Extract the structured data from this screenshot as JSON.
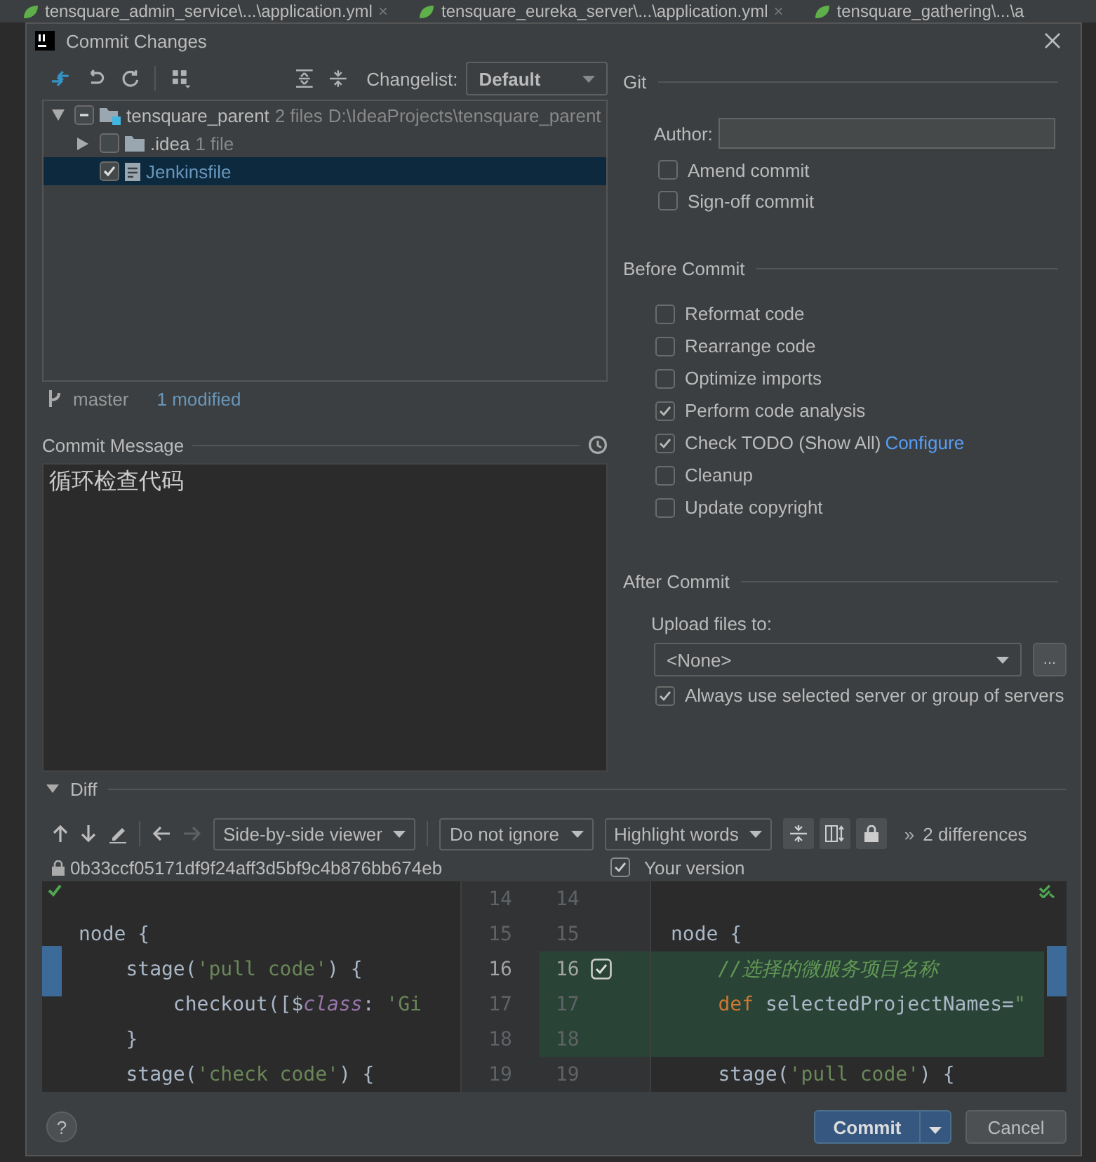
{
  "editor_tabs": [
    {
      "label": "tensquare_admin_service\\...\\application.yml",
      "close": "×"
    },
    {
      "label": "tensquare_eureka_server\\...\\application.yml",
      "close": "×"
    },
    {
      "label": "tensquare_gathering\\...\\a"
    }
  ],
  "window": {
    "title": "Commit Changes"
  },
  "changes": {
    "changelist_label": "Changelist:",
    "changelist": "Default",
    "tree": [
      {
        "name": "tensquare_parent",
        "kind": "module",
        "info": "2 files",
        "path": "D:\\IdeaProjects\\tensquare_parent",
        "expanded": true,
        "checked": false,
        "mixed": true,
        "selected": false,
        "children": [
          {
            "name": ".idea",
            "kind": "folder",
            "info": "1 file",
            "expanded": false,
            "checked": false,
            "selected": false
          },
          {
            "name": "Jenkinsfile",
            "kind": "file",
            "checked": true,
            "selected": true
          }
        ]
      }
    ],
    "branch": "master",
    "status": "1 modified"
  },
  "commit_message": {
    "label": "Commit Message",
    "text": "循环检查代码"
  },
  "git": {
    "title": "Git",
    "author_label": "Author:",
    "options": [
      {
        "label": "Amend commit",
        "checked": false
      },
      {
        "label": "Sign-off commit",
        "checked": false
      }
    ]
  },
  "before_commit": {
    "title": "Before Commit",
    "options": [
      {
        "label": "Reformat code",
        "checked": false
      },
      {
        "label": "Rearrange code",
        "checked": false
      },
      {
        "label": "Optimize imports",
        "checked": false
      },
      {
        "label": "Perform code analysis",
        "checked": true
      },
      {
        "label": "Check TODO (Show All)",
        "checked": true,
        "link": "Configure"
      },
      {
        "label": "Cleanup",
        "checked": false
      },
      {
        "label": "Update copyright",
        "checked": false
      }
    ]
  },
  "after_commit": {
    "title": "After Commit",
    "upload_label": "Upload files to:",
    "server": "<None>",
    "browse": "...",
    "always": {
      "label": "Always use selected server or group of servers",
      "checked": true
    }
  },
  "diff": {
    "title": "Diff",
    "expanded": true,
    "viewer": "Side-by-side viewer",
    "ignore": "Do not ignore",
    "highlight": "Highlight words",
    "more": "»",
    "count": "2 differences",
    "left_revision": "0b33ccf05171df9f24aff3d5bf9c4b876bb674eb",
    "right_checked": true,
    "right_label": "Your version",
    "rows": [
      {
        "left_no": "14",
        "right_no": "14",
        "changed": false,
        "left": [],
        "right": []
      },
      {
        "left_no": "15",
        "right_no": "15",
        "changed": false,
        "left": [
          {
            "kind": "plain",
            "text": "node {"
          }
        ],
        "right": [
          {
            "kind": "plain",
            "text": "node {"
          }
        ]
      },
      {
        "left_no": "16",
        "right_no": "16",
        "changed": true,
        "include": true,
        "left": [
          {
            "kind": "plain",
            "text": "    stage("
          },
          {
            "kind": "string",
            "text": "'pull code'"
          },
          {
            "kind": "plain",
            "text": ") {"
          }
        ],
        "right": [
          {
            "kind": "comment",
            "text": "    //选择的微服务项目名称"
          }
        ]
      },
      {
        "left_no": "17",
        "right_no": "17",
        "changed": true,
        "left": [
          {
            "kind": "plain",
            "text": "        checkout([$"
          },
          {
            "kind": "field",
            "text": "class"
          },
          {
            "kind": "plain",
            "text": ": "
          },
          {
            "kind": "string",
            "text": "'Gi"
          }
        ],
        "right": [
          {
            "kind": "keyword",
            "text": "    def "
          },
          {
            "kind": "plain",
            "text": "selectedProjectNames="
          },
          {
            "kind": "string",
            "text": "\""
          }
        ]
      },
      {
        "left_no": "18",
        "right_no": "18",
        "changed": true,
        "left": [
          {
            "kind": "plain",
            "text": "    }"
          }
        ],
        "right": []
      },
      {
        "left_no": "19",
        "right_no": "19",
        "changed": false,
        "left": [
          {
            "kind": "plain",
            "text": "    stage("
          },
          {
            "kind": "string",
            "text": "'check code'"
          },
          {
            "kind": "plain",
            "text": ") {"
          }
        ],
        "right": [
          {
            "kind": "plain",
            "text": "    stage("
          },
          {
            "kind": "string",
            "text": "'pull code'"
          },
          {
            "kind": "plain",
            "text": ") {"
          }
        ]
      }
    ]
  },
  "footer": {
    "help": "?",
    "commit": "Commit",
    "cancel": "Cancel"
  }
}
